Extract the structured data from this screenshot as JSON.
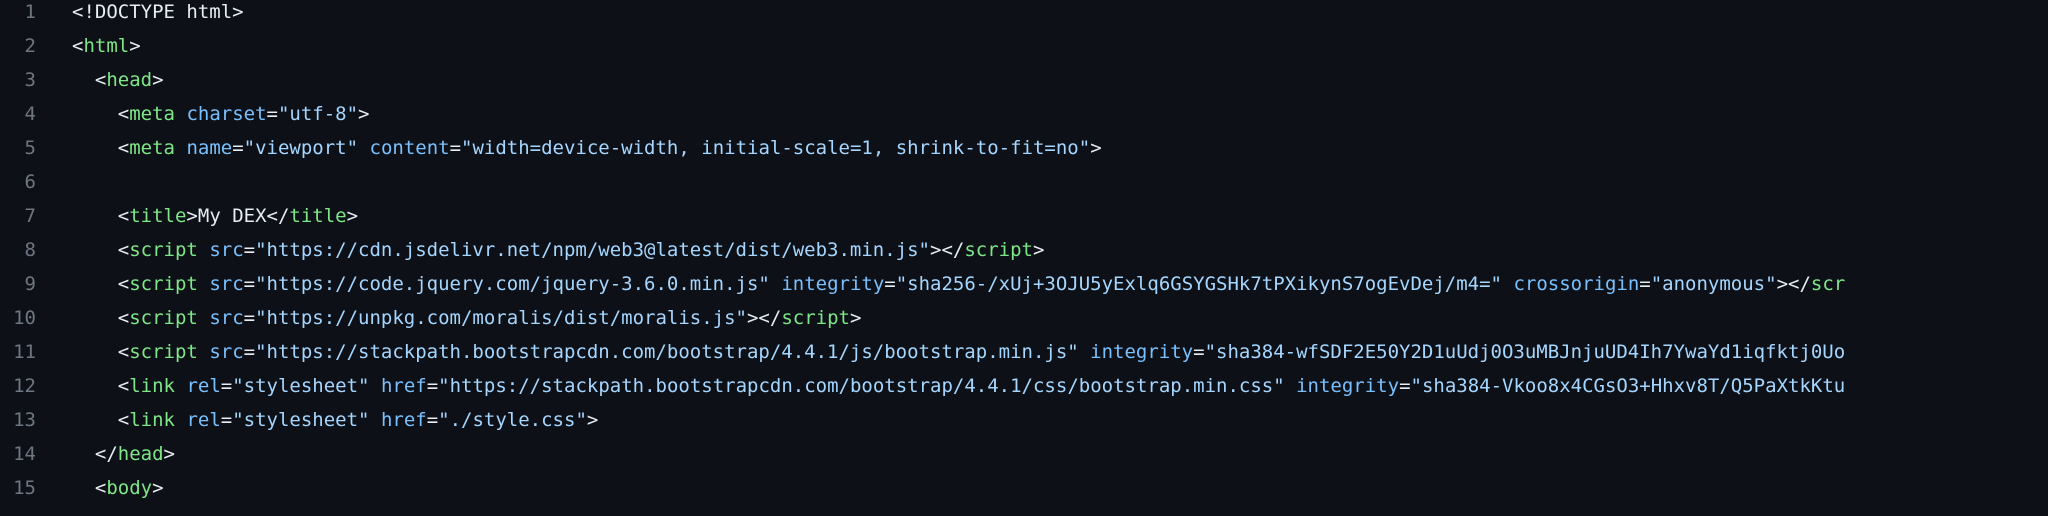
{
  "editor": {
    "lines": [
      {
        "number": "1",
        "indent": "",
        "tokens": [
          {
            "t": "punct",
            "v": "<!DOCTYPE html>"
          }
        ]
      },
      {
        "number": "2",
        "indent": "",
        "tokens": [
          {
            "t": "punct",
            "v": "<"
          },
          {
            "t": "tag",
            "v": "html"
          },
          {
            "t": "punct",
            "v": ">"
          }
        ]
      },
      {
        "number": "3",
        "indent": "  ",
        "tokens": [
          {
            "t": "punct",
            "v": "<"
          },
          {
            "t": "tag",
            "v": "head"
          },
          {
            "t": "punct",
            "v": ">"
          }
        ]
      },
      {
        "number": "4",
        "indent": "    ",
        "tokens": [
          {
            "t": "punct",
            "v": "<"
          },
          {
            "t": "tag",
            "v": "meta"
          },
          {
            "t": "punct",
            "v": " "
          },
          {
            "t": "attr",
            "v": "charset"
          },
          {
            "t": "punct",
            "v": "="
          },
          {
            "t": "str",
            "v": "\"utf-8\""
          },
          {
            "t": "punct",
            "v": ">"
          }
        ]
      },
      {
        "number": "5",
        "indent": "    ",
        "tokens": [
          {
            "t": "punct",
            "v": "<"
          },
          {
            "t": "tag",
            "v": "meta"
          },
          {
            "t": "punct",
            "v": " "
          },
          {
            "t": "attr",
            "v": "name"
          },
          {
            "t": "punct",
            "v": "="
          },
          {
            "t": "str",
            "v": "\"viewport\""
          },
          {
            "t": "punct",
            "v": " "
          },
          {
            "t": "attr",
            "v": "content"
          },
          {
            "t": "punct",
            "v": "="
          },
          {
            "t": "str",
            "v": "\"width=device-width, initial-scale=1, shrink-to-fit=no\""
          },
          {
            "t": "punct",
            "v": ">"
          }
        ]
      },
      {
        "number": "6",
        "indent": "",
        "tokens": []
      },
      {
        "number": "7",
        "indent": "    ",
        "tokens": [
          {
            "t": "punct",
            "v": "<"
          },
          {
            "t": "tag",
            "v": "title"
          },
          {
            "t": "punct",
            "v": ">"
          },
          {
            "t": "text",
            "v": "My DEX"
          },
          {
            "t": "punct",
            "v": "</"
          },
          {
            "t": "tag",
            "v": "title"
          },
          {
            "t": "punct",
            "v": ">"
          }
        ]
      },
      {
        "number": "8",
        "indent": "    ",
        "tokens": [
          {
            "t": "punct",
            "v": "<"
          },
          {
            "t": "tag",
            "v": "script"
          },
          {
            "t": "punct",
            "v": " "
          },
          {
            "t": "attr",
            "v": "src"
          },
          {
            "t": "punct",
            "v": "="
          },
          {
            "t": "str",
            "v": "\"https://cdn.jsdelivr.net/npm/web3@latest/dist/web3.min.js\""
          },
          {
            "t": "punct",
            "v": "></"
          },
          {
            "t": "tag",
            "v": "script"
          },
          {
            "t": "punct",
            "v": ">"
          }
        ]
      },
      {
        "number": "9",
        "indent": "    ",
        "tokens": [
          {
            "t": "punct",
            "v": "<"
          },
          {
            "t": "tag",
            "v": "script"
          },
          {
            "t": "punct",
            "v": " "
          },
          {
            "t": "attr",
            "v": "src"
          },
          {
            "t": "punct",
            "v": "="
          },
          {
            "t": "str",
            "v": "\"https://code.jquery.com/jquery-3.6.0.min.js\""
          },
          {
            "t": "punct",
            "v": " "
          },
          {
            "t": "attr",
            "v": "integrity"
          },
          {
            "t": "punct",
            "v": "="
          },
          {
            "t": "str",
            "v": "\"sha256-/xUj+3OJU5yExlq6GSYGSHk7tPXikynS7ogEvDej/m4=\""
          },
          {
            "t": "punct",
            "v": " "
          },
          {
            "t": "attr",
            "v": "crossorigin"
          },
          {
            "t": "punct",
            "v": "="
          },
          {
            "t": "str",
            "v": "\"anonymous\""
          },
          {
            "t": "punct",
            "v": "></"
          },
          {
            "t": "tag",
            "v": "scr"
          }
        ]
      },
      {
        "number": "10",
        "indent": "    ",
        "tokens": [
          {
            "t": "punct",
            "v": "<"
          },
          {
            "t": "tag",
            "v": "script"
          },
          {
            "t": "punct",
            "v": " "
          },
          {
            "t": "attr",
            "v": "src"
          },
          {
            "t": "punct",
            "v": "="
          },
          {
            "t": "str",
            "v": "\"https://unpkg.com/moralis/dist/moralis.js\""
          },
          {
            "t": "punct",
            "v": "></"
          },
          {
            "t": "tag",
            "v": "script"
          },
          {
            "t": "punct",
            "v": ">"
          }
        ]
      },
      {
        "number": "11",
        "indent": "    ",
        "tokens": [
          {
            "t": "punct",
            "v": "<"
          },
          {
            "t": "tag",
            "v": "script"
          },
          {
            "t": "punct",
            "v": " "
          },
          {
            "t": "attr",
            "v": "src"
          },
          {
            "t": "punct",
            "v": "="
          },
          {
            "t": "str",
            "v": "\"https://stackpath.bootstrapcdn.com/bootstrap/4.4.1/js/bootstrap.min.js\""
          },
          {
            "t": "punct",
            "v": " "
          },
          {
            "t": "attr",
            "v": "integrity"
          },
          {
            "t": "punct",
            "v": "="
          },
          {
            "t": "str",
            "v": "\"sha384-wfSDF2E50Y2D1uUdj0O3uMBJnjuUD4Ih7YwaYd1iqfktj0Uo"
          }
        ]
      },
      {
        "number": "12",
        "indent": "    ",
        "tokens": [
          {
            "t": "punct",
            "v": "<"
          },
          {
            "t": "tag",
            "v": "link"
          },
          {
            "t": "punct",
            "v": " "
          },
          {
            "t": "attr",
            "v": "rel"
          },
          {
            "t": "punct",
            "v": "="
          },
          {
            "t": "str",
            "v": "\"stylesheet\""
          },
          {
            "t": "punct",
            "v": " "
          },
          {
            "t": "attr",
            "v": "href"
          },
          {
            "t": "punct",
            "v": "="
          },
          {
            "t": "str",
            "v": "\"https://stackpath.bootstrapcdn.com/bootstrap/4.4.1/css/bootstrap.min.css\""
          },
          {
            "t": "punct",
            "v": " "
          },
          {
            "t": "attr",
            "v": "integrity"
          },
          {
            "t": "punct",
            "v": "="
          },
          {
            "t": "str",
            "v": "\"sha384-Vkoo8x4CGsO3+Hhxv8T/Q5PaXtkKtu"
          }
        ]
      },
      {
        "number": "13",
        "indent": "    ",
        "tokens": [
          {
            "t": "punct",
            "v": "<"
          },
          {
            "t": "tag",
            "v": "link"
          },
          {
            "t": "punct",
            "v": " "
          },
          {
            "t": "attr",
            "v": "rel"
          },
          {
            "t": "punct",
            "v": "="
          },
          {
            "t": "str",
            "v": "\"stylesheet\""
          },
          {
            "t": "punct",
            "v": " "
          },
          {
            "t": "attr",
            "v": "href"
          },
          {
            "t": "punct",
            "v": "="
          },
          {
            "t": "str",
            "v": "\"./style.css\""
          },
          {
            "t": "punct",
            "v": ">"
          }
        ]
      },
      {
        "number": "14",
        "indent": "  ",
        "tokens": [
          {
            "t": "punct",
            "v": "</"
          },
          {
            "t": "tag",
            "v": "head"
          },
          {
            "t": "punct",
            "v": ">"
          }
        ]
      },
      {
        "number": "15",
        "indent": "  ",
        "tokens": [
          {
            "t": "punct",
            "v": "<"
          },
          {
            "t": "tag",
            "v": "body"
          },
          {
            "t": "punct",
            "v": ">"
          }
        ]
      }
    ]
  }
}
